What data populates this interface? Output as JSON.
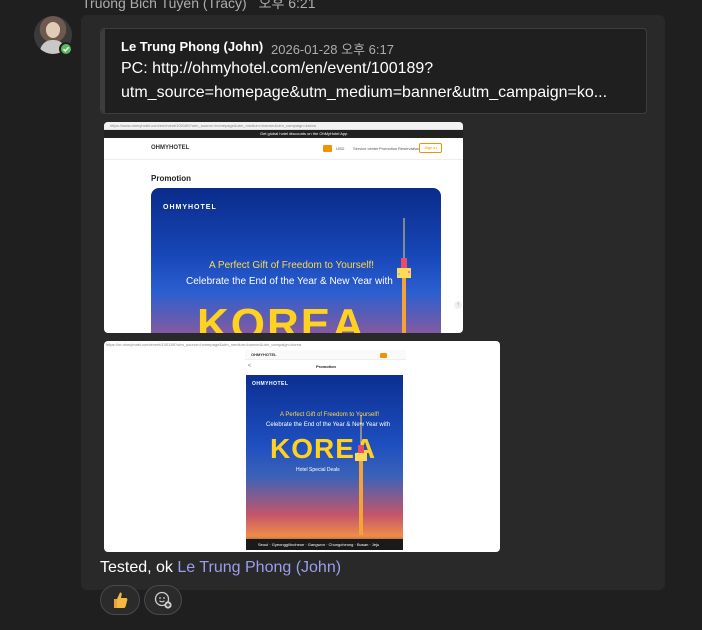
{
  "message": {
    "sender_name": "Truong Bich Tuyen (Tracy)",
    "sender_time": "오후 6:21",
    "body_prefix": "Tested, ok",
    "mention": "Le Trung Phong (John)"
  },
  "quote": {
    "author": "Le Trung Phong (John)",
    "timestamp": "2026-01-28 오후 6:17",
    "line1": "PC: http://ohmyhotel.com/en/event/100189?",
    "line2": "utm_source=homepage&utm_medium=banner&utm_campaign=ko..."
  },
  "attachment1": {
    "url": "https://www.ohmyhotel.com/en/event/100189?utm_source=homepage&utm_medium=banner&utm_campaign=korea",
    "top_banner": "Get global hotel discounts on the OhMyHotel App",
    "logo": "OHMYHOTEL",
    "currency": "USD",
    "nav": [
      "Service center",
      "Promotion",
      "Reservation"
    ],
    "sign_in": "Sign in",
    "section_title": "Promotion",
    "hero_logo": "OHMYHOTEL",
    "hero_line1": "A Perfect Gift of Freedom to Yourself!",
    "hero_line2": "Celebrate the End of the Year & New Year with",
    "hero_big": "KOREA"
  },
  "attachment2": {
    "url": "https://m.ohmyhotel.com/event/100189?utm_source=homepage&utm_medium=banner&utm_campaign=korea",
    "logo": "OHMYHOTEL",
    "back": "<",
    "section_title": "Promotion",
    "poster_logo": "OHMYHOTEL",
    "poster_line1": "A Perfect Gift of Freedom to Yourself!",
    "poster_line2": "Celebrate the End of the Year & New Year with",
    "poster_big": "KOREA",
    "poster_sub": "Hotel Special Deals",
    "poster_footer": "Seoul · Gyeonggi/Incheon · Gangwon · Chungcheong · Busan · Jeju"
  },
  "reactions": {
    "thumbs_icon": "thumbs-up-icon",
    "add_icon": "add-reaction-icon"
  },
  "colors": {
    "background": "#1f1f1f",
    "bubble": "#292929",
    "mention": "#9a9dec",
    "presence": "#5cb85c",
    "brand_orange": "#f39200",
    "korea_yellow": "#ffd21f"
  }
}
